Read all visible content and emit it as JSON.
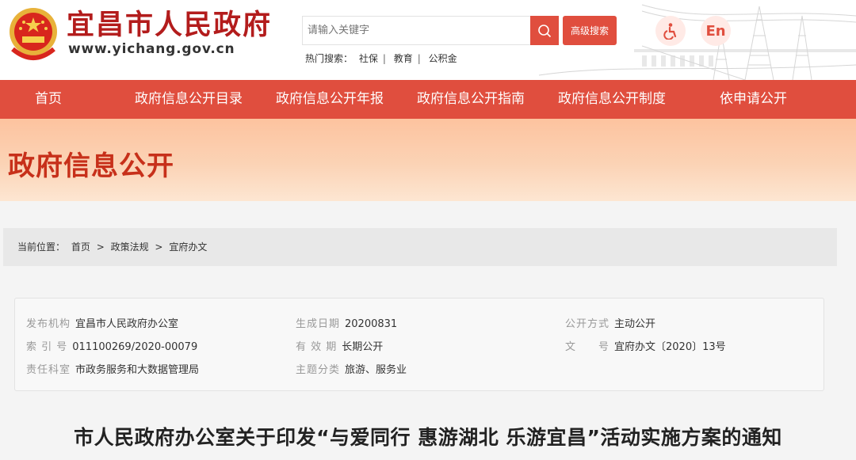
{
  "header": {
    "site_name": "宜昌市人民政府",
    "site_url": "www.yichang.gov.cn",
    "search_placeholder": "请输入关键字",
    "advanced_search": "高级搜索",
    "hot_label": "热门搜索：",
    "hot_items": [
      "社保",
      "教育",
      "公积金"
    ],
    "en_label": "En",
    "icons": [
      "emblem-icon",
      "search-icon",
      "accessibility-icon"
    ]
  },
  "nav": {
    "items": [
      "首页",
      "政府信息公开目录",
      "政府信息公开年报",
      "政府信息公开指南",
      "政府信息公开制度",
      "依申请公开"
    ]
  },
  "banner": {
    "title": "政府信息公开"
  },
  "breadcrumb": {
    "label": "当前位置：",
    "items": [
      "首页",
      "政策法规",
      "宜府办文"
    ],
    "separator": ">"
  },
  "info": {
    "publisher_label": "发布机构",
    "publisher": "宜昌市人民政府办公室",
    "date_label": "生成日期",
    "date": "20200831",
    "open_mode_label": "公开方式",
    "open_mode": "主动公开",
    "index_label": "索 引 号",
    "index": "011100269/2020-00079",
    "validity_label": "有 效 期",
    "validity": "长期公开",
    "doc_no_label": "文　　号",
    "doc_no": "宜府办文〔2020〕13号",
    "office_label": "责任科室",
    "office": "市政务服务和大数据管理局",
    "topic_label": "主题分类",
    "topic": "旅游、服务业"
  },
  "article": {
    "title": "市人民政府办公室关于印发“与爱同行 惠游湖北 乐游宜昌”活动实施方案的通知"
  },
  "colors": {
    "brand_red": "#e04e3e",
    "title_red": "#b31c1c",
    "banner_peach": "#fdc39f"
  }
}
